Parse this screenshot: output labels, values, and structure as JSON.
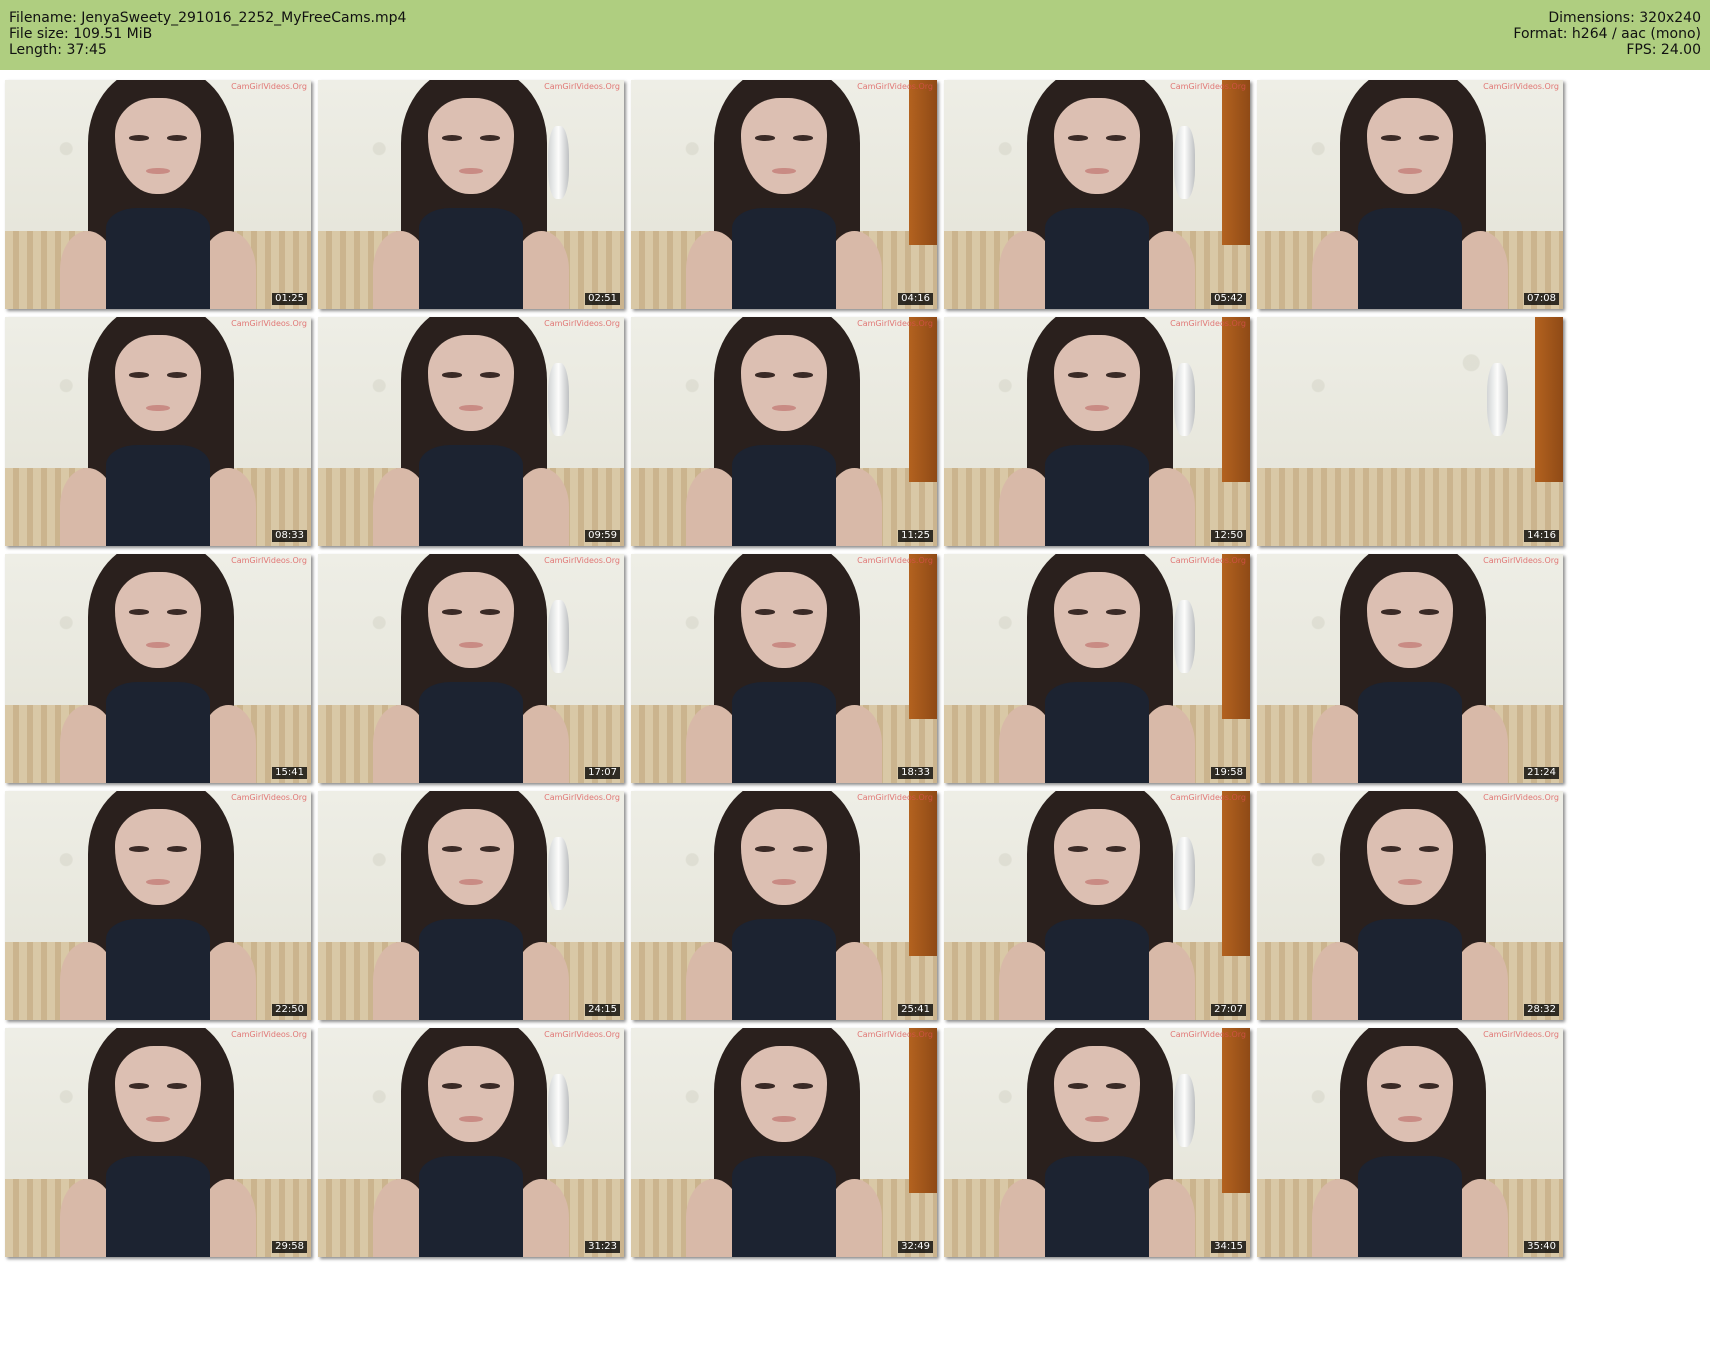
{
  "header": {
    "filename_line": "Filename: JenyaSweety_291016_2252_MyFreeCams.mp4",
    "filesize_line": "File size: 109.51 MiB",
    "length_line": "Length: 37:45",
    "dimensions_line": "Dimensions: 320x240",
    "format_line": "Format: h264 / aac (mono)",
    "fps_line": "FPS: 24.00"
  },
  "colors": {
    "header_background": "#afce80",
    "timestamp_background": "#000000",
    "timestamp_text": "#ffffff"
  },
  "thumbnails": [
    {
      "timestamp": "01:25",
      "watermark": "CamGirlVideos.Org",
      "scene": "person"
    },
    {
      "timestamp": "02:51",
      "watermark": "CamGirlVideos.Org",
      "scene": "person"
    },
    {
      "timestamp": "04:16",
      "watermark": "CamGirlVideos.Org",
      "scene": "person"
    },
    {
      "timestamp": "05:42",
      "watermark": "CamGirlVideos.Org",
      "scene": "person"
    },
    {
      "timestamp": "07:08",
      "watermark": "CamGirlVideos.Org",
      "scene": "person"
    },
    {
      "timestamp": "08:33",
      "watermark": "CamGirlVideos.Org",
      "scene": "person"
    },
    {
      "timestamp": "09:59",
      "watermark": "CamGirlVideos.Org",
      "scene": "person"
    },
    {
      "timestamp": "11:25",
      "watermark": "CamGirlVideos.Org",
      "scene": "person"
    },
    {
      "timestamp": "12:50",
      "watermark": "CamGirlVideos.Org",
      "scene": "person"
    },
    {
      "timestamp": "14:16",
      "watermark": "",
      "scene": "empty-room"
    },
    {
      "timestamp": "15:41",
      "watermark": "CamGirlVideos.Org",
      "scene": "person"
    },
    {
      "timestamp": "17:07",
      "watermark": "CamGirlVideos.Org",
      "scene": "person"
    },
    {
      "timestamp": "18:33",
      "watermark": "CamGirlVideos.Org",
      "scene": "person"
    },
    {
      "timestamp": "19:58",
      "watermark": "CamGirlVideos.Org",
      "scene": "person"
    },
    {
      "timestamp": "21:24",
      "watermark": "CamGirlVideos.Org",
      "scene": "person"
    },
    {
      "timestamp": "22:50",
      "watermark": "CamGirlVideos.Org",
      "scene": "person"
    },
    {
      "timestamp": "24:15",
      "watermark": "CamGirlVideos.Org",
      "scene": "person"
    },
    {
      "timestamp": "25:41",
      "watermark": "CamGirlVideos.Org",
      "scene": "person"
    },
    {
      "timestamp": "27:07",
      "watermark": "CamGirlVideos.Org",
      "scene": "person"
    },
    {
      "timestamp": "28:32",
      "watermark": "CamGirlVideos.Org",
      "scene": "person"
    },
    {
      "timestamp": "29:58",
      "watermark": "CamGirlVideos.Org",
      "scene": "person"
    },
    {
      "timestamp": "31:23",
      "watermark": "CamGirlVideos.Org",
      "scene": "person"
    },
    {
      "timestamp": "32:49",
      "watermark": "CamGirlVideos.Org",
      "scene": "person"
    },
    {
      "timestamp": "34:15",
      "watermark": "CamGirlVideos.Org",
      "scene": "person"
    },
    {
      "timestamp": "35:40",
      "watermark": "CamGirlVideos.Org",
      "scene": "person"
    }
  ]
}
